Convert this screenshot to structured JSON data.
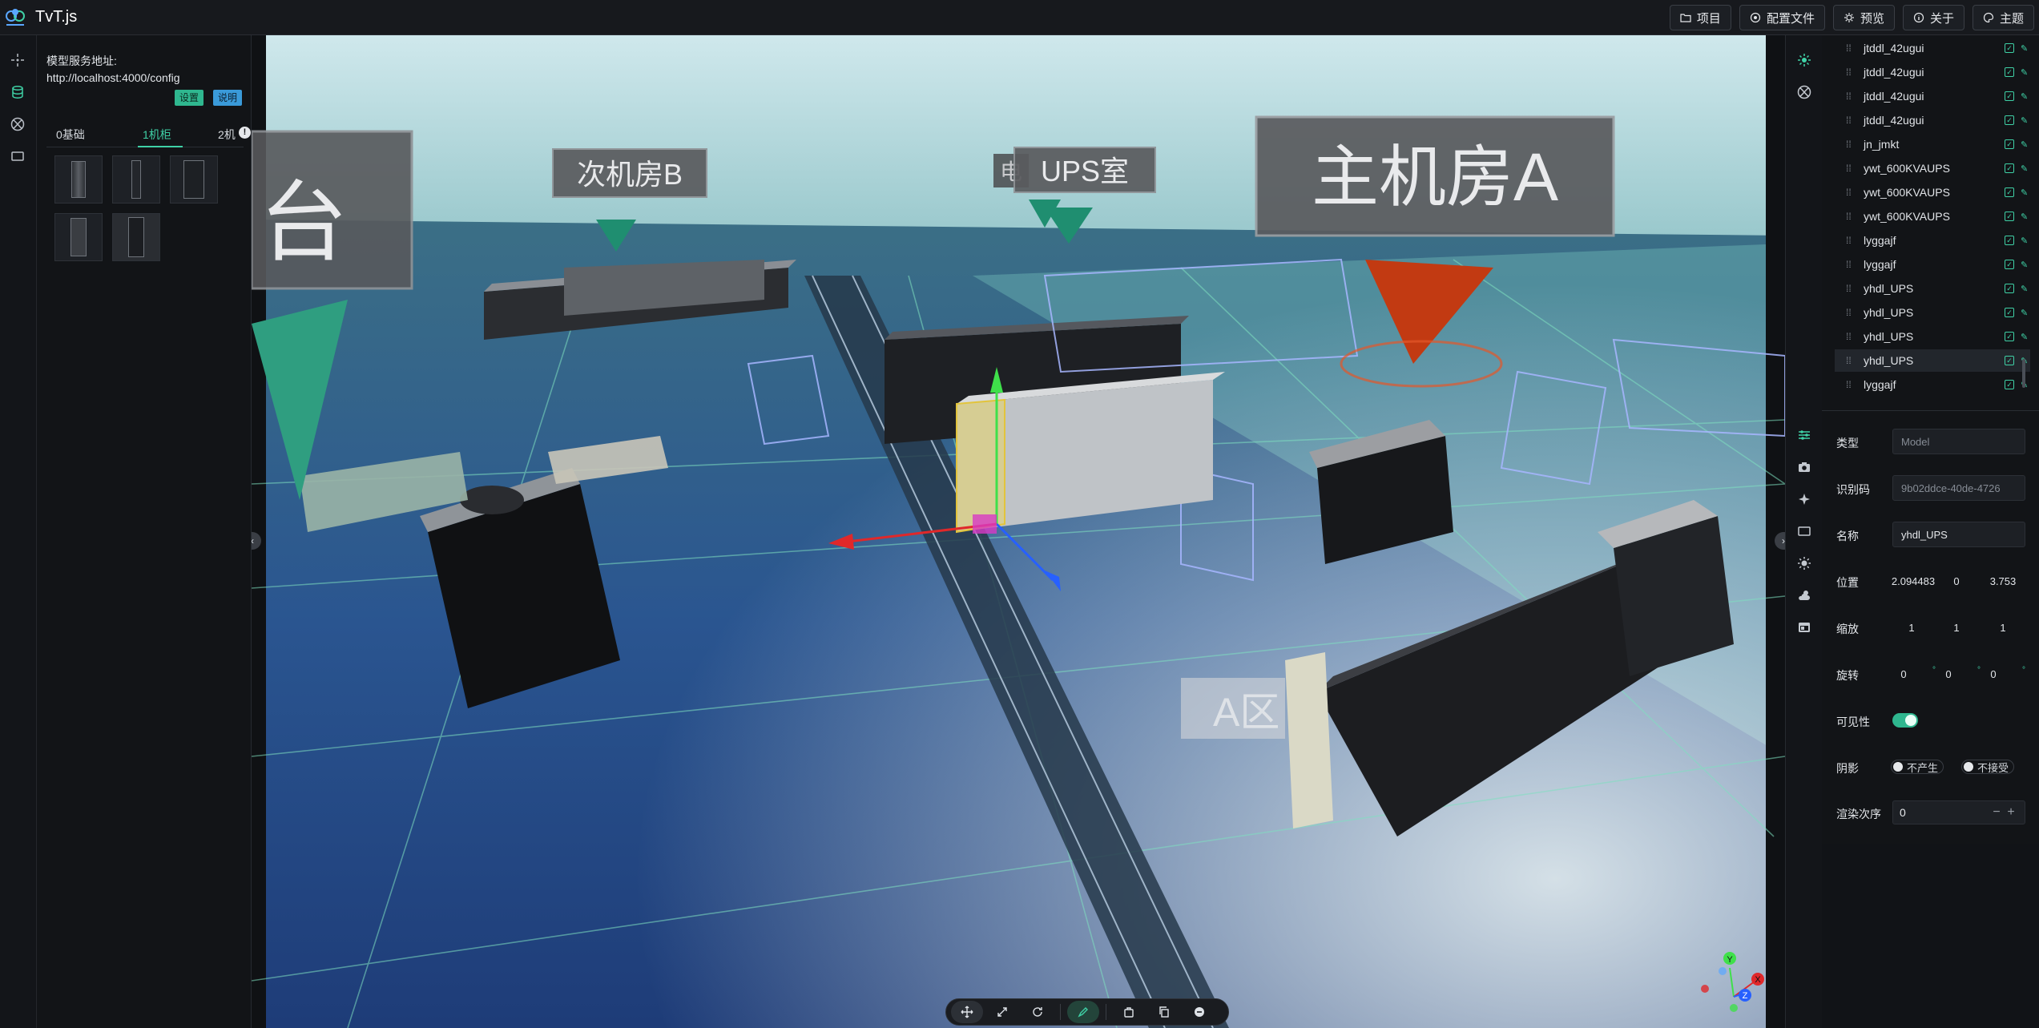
{
  "app": {
    "title": "TvT.js"
  },
  "top_actions": [
    {
      "label": "项目",
      "icon": "folder-icon"
    },
    {
      "label": "配置文件",
      "icon": "config-icon"
    },
    {
      "label": "预览",
      "icon": "preview-icon"
    },
    {
      "label": "关于",
      "icon": "info-icon"
    },
    {
      "label": "主题",
      "icon": "palette-icon"
    }
  ],
  "left_panel": {
    "server_label": "模型服务地址:",
    "server_url": "http://localhost:4000/config",
    "set_button": "设置",
    "help_button": "说明",
    "tabs": [
      "0基础",
      "1机柜",
      "2机"
    ],
    "active_tab": "1机柜",
    "info_badge": "!"
  },
  "viewport": {
    "labels": {
      "platform": "台",
      "room_b": "次机房B",
      "ups_room": "UPS室",
      "ups_room_prefix": "电",
      "room_a": "主机房A",
      "floor_text": "A区"
    },
    "gizmo_axes": {
      "x": "X",
      "y": "Y",
      "z": "Z"
    }
  },
  "tree": {
    "items": [
      {
        "name": "jtddl_42ugui"
      },
      {
        "name": "jtddl_42ugui"
      },
      {
        "name": "jtddl_42ugui"
      },
      {
        "name": "jtddl_42ugui"
      },
      {
        "name": "jn_jmkt"
      },
      {
        "name": "ywt_600KVAUPS"
      },
      {
        "name": "ywt_600KVAUPS"
      },
      {
        "name": "ywt_600KVAUPS"
      },
      {
        "name": "lyggajf"
      },
      {
        "name": "lyggajf"
      },
      {
        "name": "yhdl_UPS"
      },
      {
        "name": "yhdl_UPS"
      },
      {
        "name": "yhdl_UPS"
      },
      {
        "name": "yhdl_UPS",
        "selected": true
      },
      {
        "name": "lyggajf"
      }
    ]
  },
  "properties": {
    "type_label": "类型",
    "type_value": "Model",
    "id_label": "识别码",
    "id_value": "9b02ddce-40de-4726",
    "name_label": "名称",
    "name_value": "yhdl_UPS",
    "position_label": "位置",
    "position": [
      "2.094483",
      "0",
      "3.753"
    ],
    "scale_label": "缩放",
    "scale": [
      "1",
      "1",
      "1"
    ],
    "rotation_label": "旋转",
    "rotation": [
      "0",
      "0",
      "0"
    ],
    "visible_label": "可见性",
    "visible": true,
    "shadow_label": "阴影",
    "cast_shadow_label": "不产生",
    "receive_shadow_label": "不接受",
    "render_order_label": "渲染次序",
    "render_order": "0"
  },
  "colors": {
    "accent": "#3fd1a6",
    "background": "#121417"
  }
}
